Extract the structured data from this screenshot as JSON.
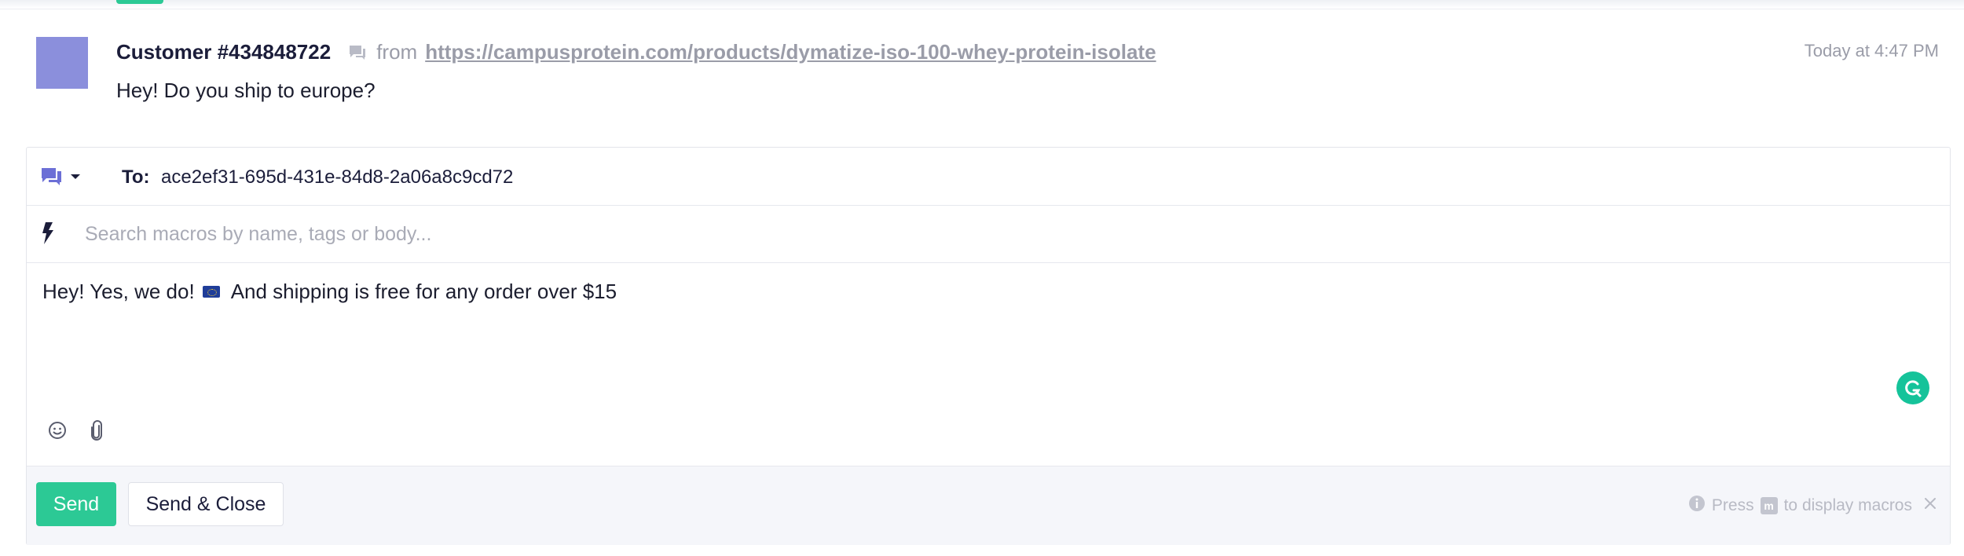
{
  "message": {
    "customer_name": "Customer #434848722",
    "from_label": "from",
    "source_url": "https://campusprotein.com/products/dymatize-iso-100-whey-protein-isolate",
    "timestamp": "Today at 4:47 PM",
    "body": "Hey! Do you ship to europe?"
  },
  "composer": {
    "to_label": "To:",
    "to_value": "ace2ef31-695d-431e-84d8-2a06a8c9cd72",
    "macro_search_placeholder": "Search macros by name, tags or body...",
    "reply_text_part1": "Hey! Yes, we do!",
    "reply_text_part2": "And shipping is free for any order over $15",
    "send_label": "Send",
    "send_close_label": "Send & Close",
    "hint_prefix": "Press",
    "hint_key": "m",
    "hint_suffix": "to display macros"
  },
  "icons": {
    "channel": "chat-bubbles-icon",
    "macro": "lightning-bolt-icon",
    "emoji": "smiley-icon",
    "attach": "paperclip-icon",
    "grammarly": "grammarly-icon",
    "info": "info-icon",
    "close": "close-icon"
  },
  "colors": {
    "accent_green": "#2cc995",
    "avatar": "#8b8fdc",
    "channel_icon": "#6c6fd6",
    "grammarly": "#15c39a"
  }
}
